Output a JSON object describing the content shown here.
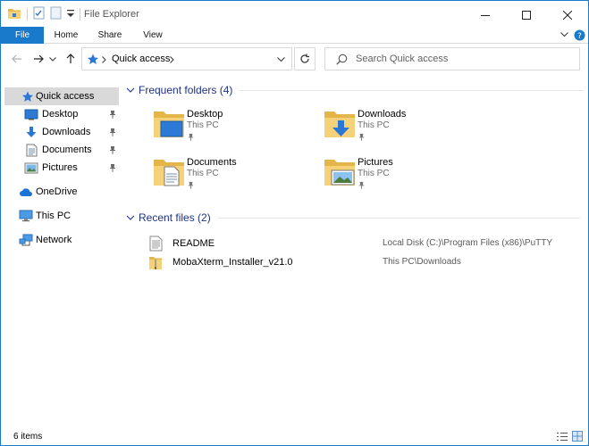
{
  "window": {
    "title": "File Explorer",
    "accent": "#1979ca"
  },
  "ribbon": {
    "tabs": [
      "File",
      "Home",
      "Share",
      "View"
    ]
  },
  "address": {
    "path": "Quick access",
    "search_placeholder": "Search Quick access"
  },
  "sidebar": {
    "items": [
      {
        "label": "Quick access",
        "icon": "star-icon",
        "selected": true
      },
      {
        "label": "Desktop",
        "icon": "desktop-icon",
        "pinned": true
      },
      {
        "label": "Downloads",
        "icon": "download-icon",
        "pinned": true
      },
      {
        "label": "Documents",
        "icon": "documents-icon",
        "pinned": true
      },
      {
        "label": "Pictures",
        "icon": "pictures-icon",
        "pinned": true
      },
      {
        "label": "OneDrive",
        "icon": "cloud-icon"
      },
      {
        "label": "This PC",
        "icon": "computer-icon"
      },
      {
        "label": "Network",
        "icon": "network-icon"
      }
    ]
  },
  "frequent": {
    "header": "Frequent folders (4)",
    "folders": [
      {
        "name": "Desktop",
        "location": "This PC"
      },
      {
        "name": "Downloads",
        "location": "This PC"
      },
      {
        "name": "Documents",
        "location": "This PC"
      },
      {
        "name": "Pictures",
        "location": "This PC"
      }
    ]
  },
  "recent": {
    "header": "Recent files (2)",
    "files": [
      {
        "name": "README",
        "path": "Local Disk (C:)\\Program Files (x86)\\PuTTY"
      },
      {
        "name": "MobaXterm_Installer_v21.0",
        "path": "This PC\\Downloads"
      }
    ]
  },
  "status": {
    "count": "6 items"
  }
}
